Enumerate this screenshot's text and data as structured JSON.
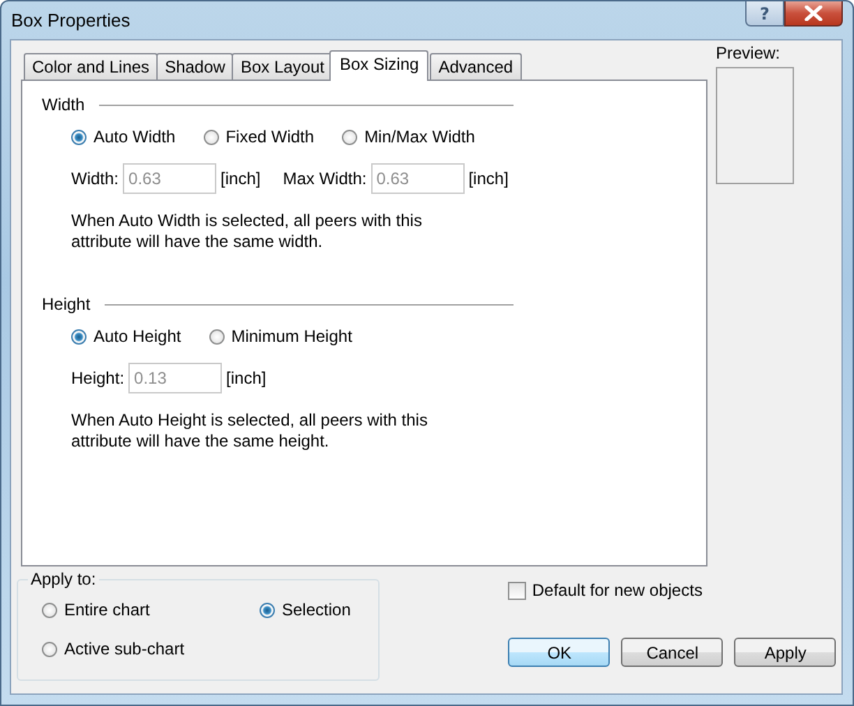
{
  "window": {
    "title": "Box Properties",
    "help_button": "?"
  },
  "tabs": [
    {
      "label": "Color and Lines",
      "selected": false
    },
    {
      "label": "Shadow",
      "selected": false
    },
    {
      "label": "Box Layout",
      "selected": false
    },
    {
      "label": "Box Sizing",
      "selected": true
    },
    {
      "label": "Advanced",
      "selected": false
    }
  ],
  "sections": [
    {
      "title": "Width",
      "options": [
        {
          "label": "Auto Width",
          "selected": true
        },
        {
          "label": "Fixed Width",
          "selected": false
        },
        {
          "label": "Min/Max Width",
          "selected": false
        }
      ],
      "fields": [
        {
          "label": "Width:",
          "value": "0.63",
          "unit": "[inch]",
          "disabled": true
        },
        {
          "label": "Max Width:",
          "value": "0.63",
          "unit": "[inch]",
          "disabled": true
        }
      ],
      "note": "When Auto Width is selected, all peers with this attribute will have the same width."
    },
    {
      "title": "Height",
      "options": [
        {
          "label": "Auto Height",
          "selected": true
        },
        {
          "label": "Minimum Height",
          "selected": false
        }
      ],
      "fields": [
        {
          "label": "Height:",
          "value": "0.13",
          "unit": "[inch]",
          "disabled": true
        }
      ],
      "note": "When Auto Height is selected, all peers with this attribute will have the same height."
    }
  ],
  "preview": {
    "label": "Preview:"
  },
  "apply_to": {
    "label": "Apply to:",
    "options": [
      {
        "label": "Entire chart",
        "selected": false
      },
      {
        "label": "Selection",
        "selected": true
      },
      {
        "label": "Active sub-chart",
        "selected": false
      }
    ]
  },
  "default_checkbox": {
    "label": "Default for new objects",
    "checked": false
  },
  "buttons": [
    {
      "label": "OK",
      "default": true
    },
    {
      "label": "Cancel",
      "default": false
    },
    {
      "label": "Apply",
      "default": false
    }
  ]
}
